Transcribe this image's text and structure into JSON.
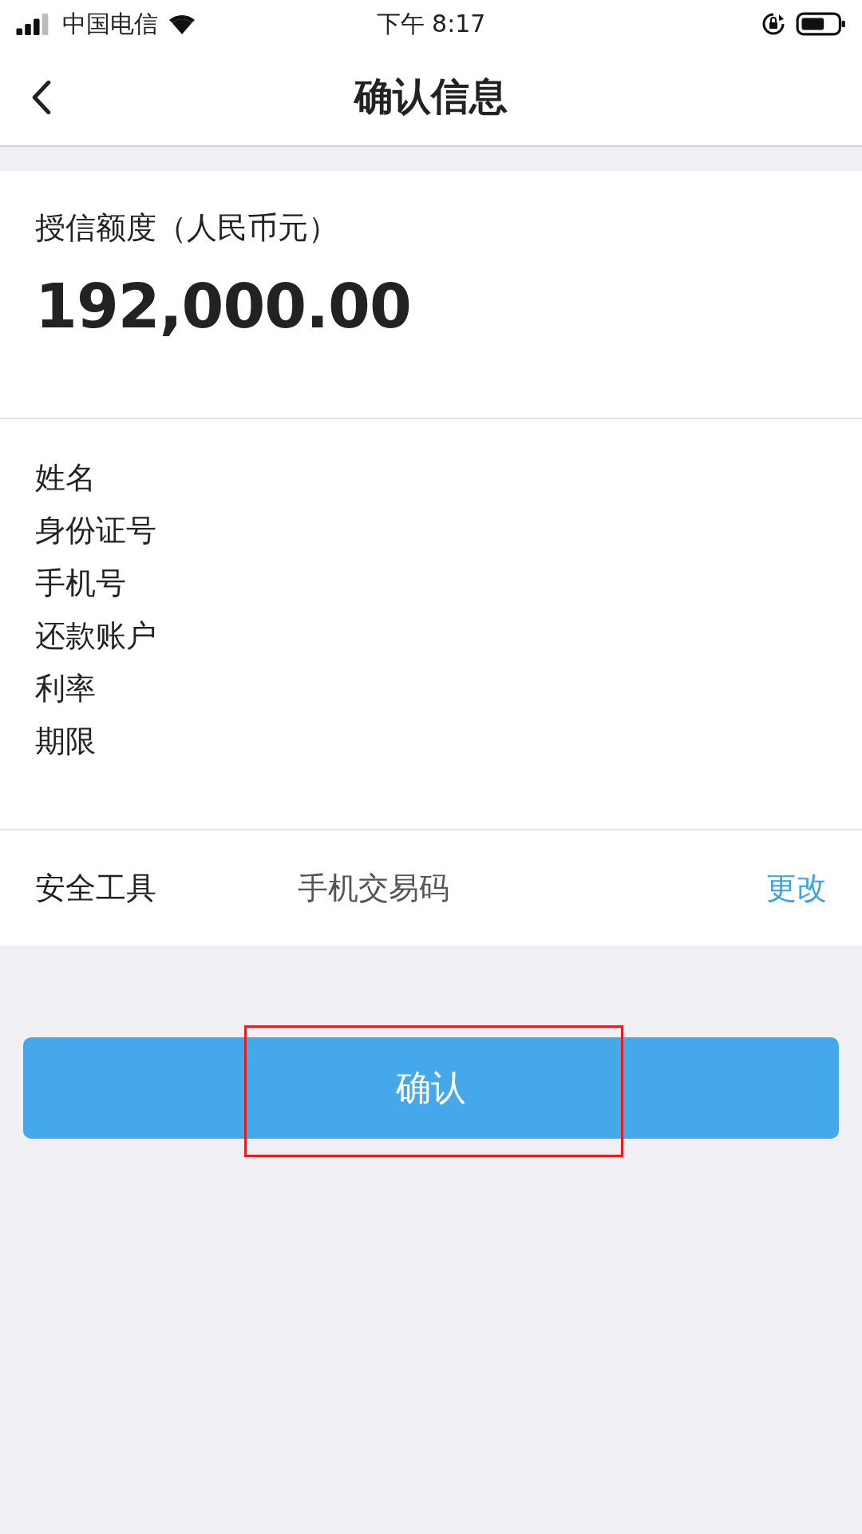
{
  "status_bar": {
    "carrier": "中国电信",
    "time": "下午 8:17"
  },
  "nav": {
    "title": "确认信息"
  },
  "credit": {
    "label": "授信额度（人民币元）",
    "amount": "192,000.00"
  },
  "fields": [
    {
      "label": "姓名"
    },
    {
      "label": "身份证号"
    },
    {
      "label": "手机号"
    },
    {
      "label": "还款账户"
    },
    {
      "label": "利率"
    },
    {
      "label": "期限"
    }
  ],
  "security": {
    "label": "安全工具",
    "value": "手机交易码",
    "action": "更改"
  },
  "confirm_button": {
    "label": "确认",
    "highlighted": true
  }
}
